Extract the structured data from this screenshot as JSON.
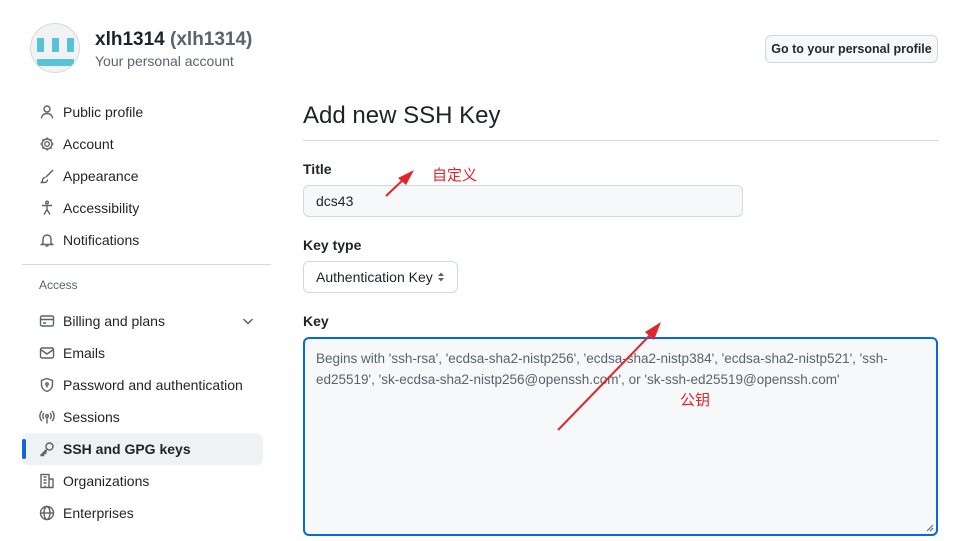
{
  "header": {
    "username": "xlh1314",
    "handle": "(xlh1314)",
    "subtitle": "Your personal account",
    "profile_button": "Go to your personal profile"
  },
  "sidebar": {
    "items": [
      {
        "label": "Public profile",
        "icon": "person-icon"
      },
      {
        "label": "Account",
        "icon": "gear-icon"
      },
      {
        "label": "Appearance",
        "icon": "paintbrush-icon"
      },
      {
        "label": "Accessibility",
        "icon": "accessibility-icon"
      },
      {
        "label": "Notifications",
        "icon": "bell-icon"
      }
    ],
    "access_heading": "Access",
    "access_items": [
      {
        "label": "Billing and plans",
        "icon": "credit-card-icon"
      },
      {
        "label": "Emails",
        "icon": "mail-icon"
      },
      {
        "label": "Password and authentication",
        "icon": "shield-lock-icon"
      },
      {
        "label": "Sessions",
        "icon": "broadcast-icon"
      },
      {
        "label": "SSH and GPG keys",
        "icon": "key-icon"
      },
      {
        "label": "Organizations",
        "icon": "organization-icon"
      },
      {
        "label": "Enterprises",
        "icon": "globe-icon"
      }
    ],
    "selected": "SSH and GPG keys",
    "accent_color": "#0969da"
  },
  "form": {
    "title": "Add new SSH Key",
    "title_label": "Title",
    "title_value": "dcs43",
    "key_type_label": "Key type",
    "key_type_value": "Authentication Key",
    "key_label": "Key",
    "key_placeholder": "Begins with 'ssh-rsa', 'ecdsa-sha2-nistp256', 'ecdsa-sha2-nistp384', 'ecdsa-sha2-nistp521', 'ssh-ed25519', 'sk-ecdsa-sha2-nistp256@openssh.com', or 'sk-ssh-ed25519@openssh.com'"
  },
  "annotations": {
    "title_note": "自定义",
    "key_note": "公钥",
    "color": "#e0252b"
  }
}
